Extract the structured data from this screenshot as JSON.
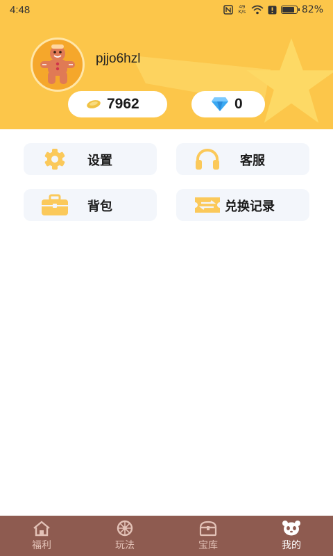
{
  "status_bar": {
    "time": "4:48",
    "net_speed_top": "49",
    "net_speed_bottom": "K/s",
    "battery": "82%",
    "battery_level": 0.82,
    "icons": [
      "nfc-icon",
      "wifi-icon",
      "alert-icon",
      "battery-icon"
    ]
  },
  "profile": {
    "username": "pjjo6hzl",
    "avatar_icon": "gingerbread-man-icon",
    "coins": "7962",
    "gems": "0"
  },
  "menu": [
    {
      "label": "设置",
      "icon": "gear-icon"
    },
    {
      "label": "客服",
      "icon": "headphones-icon"
    },
    {
      "label": "背包",
      "icon": "briefcase-icon"
    },
    {
      "label": "兑换记录",
      "icon": "ticket-icon"
    }
  ],
  "bottom_nav": [
    {
      "label": "福利",
      "icon": "home-icon",
      "active": false
    },
    {
      "label": "玩法",
      "icon": "wheel-icon",
      "active": false
    },
    {
      "label": "宝库",
      "icon": "treasure-chest-icon",
      "active": false
    },
    {
      "label": "我的",
      "icon": "panda-icon",
      "active": true
    }
  ],
  "colors": {
    "header_bg": "#fcc64a",
    "nav_bg": "#8e5b50",
    "card_bg": "#f3f6fb",
    "icon_accent": "#fbc95a"
  }
}
